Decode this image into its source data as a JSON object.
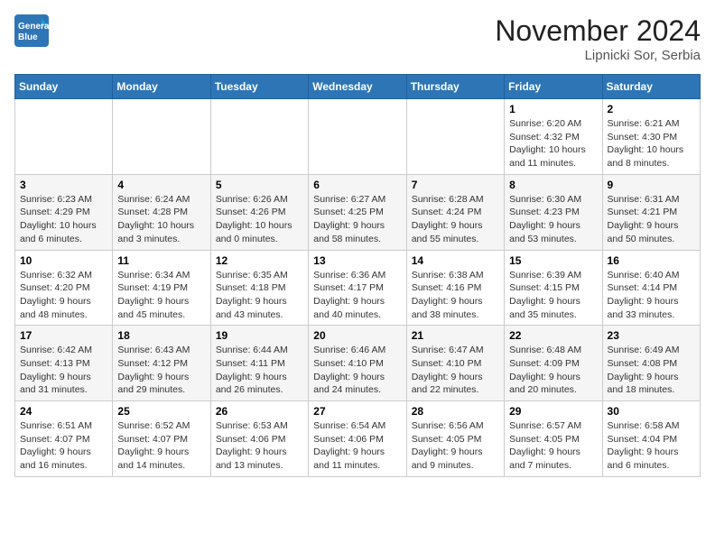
{
  "header": {
    "logo_line1": "General",
    "logo_line2": "Blue",
    "month": "November 2024",
    "location": "Lipnicki Sor, Serbia"
  },
  "days_of_week": [
    "Sunday",
    "Monday",
    "Tuesday",
    "Wednesday",
    "Thursday",
    "Friday",
    "Saturday"
  ],
  "weeks": [
    [
      {
        "day": "",
        "info": ""
      },
      {
        "day": "",
        "info": ""
      },
      {
        "day": "",
        "info": ""
      },
      {
        "day": "",
        "info": ""
      },
      {
        "day": "",
        "info": ""
      },
      {
        "day": "1",
        "info": "Sunrise: 6:20 AM\nSunset: 4:32 PM\nDaylight: 10 hours and 11 minutes."
      },
      {
        "day": "2",
        "info": "Sunrise: 6:21 AM\nSunset: 4:30 PM\nDaylight: 10 hours and 8 minutes."
      }
    ],
    [
      {
        "day": "3",
        "info": "Sunrise: 6:23 AM\nSunset: 4:29 PM\nDaylight: 10 hours and 6 minutes."
      },
      {
        "day": "4",
        "info": "Sunrise: 6:24 AM\nSunset: 4:28 PM\nDaylight: 10 hours and 3 minutes."
      },
      {
        "day": "5",
        "info": "Sunrise: 6:26 AM\nSunset: 4:26 PM\nDaylight: 10 hours and 0 minutes."
      },
      {
        "day": "6",
        "info": "Sunrise: 6:27 AM\nSunset: 4:25 PM\nDaylight: 9 hours and 58 minutes."
      },
      {
        "day": "7",
        "info": "Sunrise: 6:28 AM\nSunset: 4:24 PM\nDaylight: 9 hours and 55 minutes."
      },
      {
        "day": "8",
        "info": "Sunrise: 6:30 AM\nSunset: 4:23 PM\nDaylight: 9 hours and 53 minutes."
      },
      {
        "day": "9",
        "info": "Sunrise: 6:31 AM\nSunset: 4:21 PM\nDaylight: 9 hours and 50 minutes."
      }
    ],
    [
      {
        "day": "10",
        "info": "Sunrise: 6:32 AM\nSunset: 4:20 PM\nDaylight: 9 hours and 48 minutes."
      },
      {
        "day": "11",
        "info": "Sunrise: 6:34 AM\nSunset: 4:19 PM\nDaylight: 9 hours and 45 minutes."
      },
      {
        "day": "12",
        "info": "Sunrise: 6:35 AM\nSunset: 4:18 PM\nDaylight: 9 hours and 43 minutes."
      },
      {
        "day": "13",
        "info": "Sunrise: 6:36 AM\nSunset: 4:17 PM\nDaylight: 9 hours and 40 minutes."
      },
      {
        "day": "14",
        "info": "Sunrise: 6:38 AM\nSunset: 4:16 PM\nDaylight: 9 hours and 38 minutes."
      },
      {
        "day": "15",
        "info": "Sunrise: 6:39 AM\nSunset: 4:15 PM\nDaylight: 9 hours and 35 minutes."
      },
      {
        "day": "16",
        "info": "Sunrise: 6:40 AM\nSunset: 4:14 PM\nDaylight: 9 hours and 33 minutes."
      }
    ],
    [
      {
        "day": "17",
        "info": "Sunrise: 6:42 AM\nSunset: 4:13 PM\nDaylight: 9 hours and 31 minutes."
      },
      {
        "day": "18",
        "info": "Sunrise: 6:43 AM\nSunset: 4:12 PM\nDaylight: 9 hours and 29 minutes."
      },
      {
        "day": "19",
        "info": "Sunrise: 6:44 AM\nSunset: 4:11 PM\nDaylight: 9 hours and 26 minutes."
      },
      {
        "day": "20",
        "info": "Sunrise: 6:46 AM\nSunset: 4:10 PM\nDaylight: 9 hours and 24 minutes."
      },
      {
        "day": "21",
        "info": "Sunrise: 6:47 AM\nSunset: 4:10 PM\nDaylight: 9 hours and 22 minutes."
      },
      {
        "day": "22",
        "info": "Sunrise: 6:48 AM\nSunset: 4:09 PM\nDaylight: 9 hours and 20 minutes."
      },
      {
        "day": "23",
        "info": "Sunrise: 6:49 AM\nSunset: 4:08 PM\nDaylight: 9 hours and 18 minutes."
      }
    ],
    [
      {
        "day": "24",
        "info": "Sunrise: 6:51 AM\nSunset: 4:07 PM\nDaylight: 9 hours and 16 minutes."
      },
      {
        "day": "25",
        "info": "Sunrise: 6:52 AM\nSunset: 4:07 PM\nDaylight: 9 hours and 14 minutes."
      },
      {
        "day": "26",
        "info": "Sunrise: 6:53 AM\nSunset: 4:06 PM\nDaylight: 9 hours and 13 minutes."
      },
      {
        "day": "27",
        "info": "Sunrise: 6:54 AM\nSunset: 4:06 PM\nDaylight: 9 hours and 11 minutes."
      },
      {
        "day": "28",
        "info": "Sunrise: 6:56 AM\nSunset: 4:05 PM\nDaylight: 9 hours and 9 minutes."
      },
      {
        "day": "29",
        "info": "Sunrise: 6:57 AM\nSunset: 4:05 PM\nDaylight: 9 hours and 7 minutes."
      },
      {
        "day": "30",
        "info": "Sunrise: 6:58 AM\nSunset: 4:04 PM\nDaylight: 9 hours and 6 minutes."
      }
    ]
  ]
}
